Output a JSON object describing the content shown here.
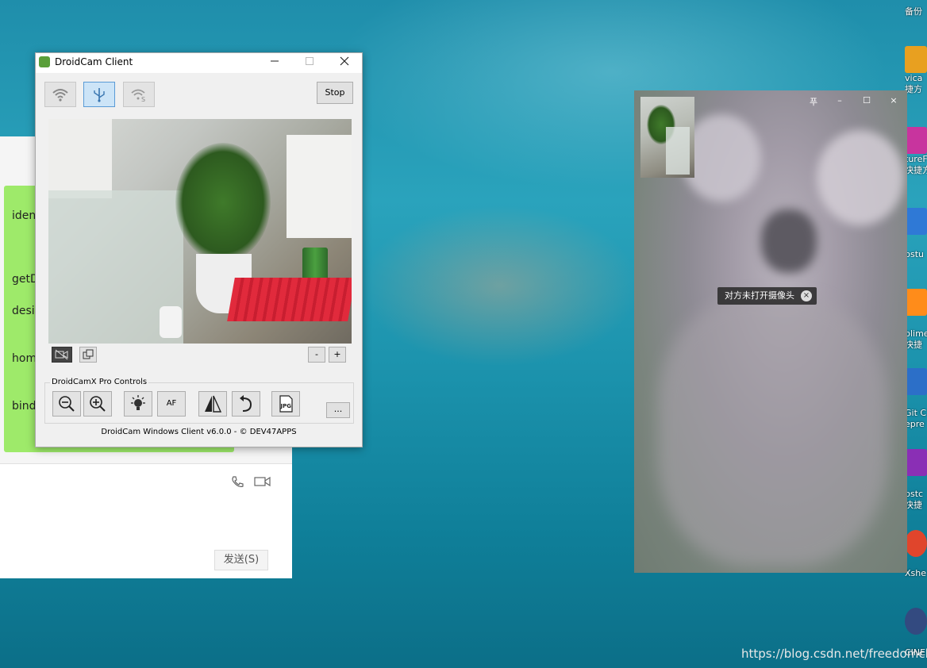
{
  "desktop": {
    "icons": [
      {
        "label": "备份",
        "color": "#3d7fd8"
      },
      {
        "label": "vica",
        "sub": "捷方",
        "color": "#e8a020"
      },
      {
        "label": "tureF",
        "sub": "快捷方",
        "color": "#c8349e"
      },
      {
        "label": "pstu",
        "color": "#2f79d6"
      },
      {
        "label": "blime",
        "sub": "快捷",
        "color": "#ff8c1a"
      },
      {
        "label": "Git C",
        "sub": "epre",
        "color": "#2c6fc8"
      },
      {
        "label": "pstc",
        "sub": "快捷",
        "color": "#8a2fb5"
      },
      {
        "label": "Xshe",
        "color": "#e0452c"
      },
      {
        "label": "CINE",
        "color": "#334a80"
      }
    ],
    "watermark": "https://blog.csdn.net/freedomcld"
  },
  "chat": {
    "lines": [
      "iden",
      "getD",
      "desi",
      "hom",
      "bind"
    ],
    "send_label": "发送(S)"
  },
  "droidcam": {
    "title": "DroidCam Client",
    "stop_label": "Stop",
    "zoom_minus": "-",
    "zoom_plus": "+",
    "pro_controls_label": "DroidCamX Pro Controls",
    "af_label": "AF",
    "more_label": "...",
    "footer": "DroidCam Windows Client v6.0.0 - © DEV47APPS"
  },
  "video_call": {
    "pin_label": "푸",
    "minimize_label": "–",
    "maximize_label": "☐",
    "close_label": "×",
    "toast": "对方未打开摄像头",
    "toast_close": "×"
  }
}
